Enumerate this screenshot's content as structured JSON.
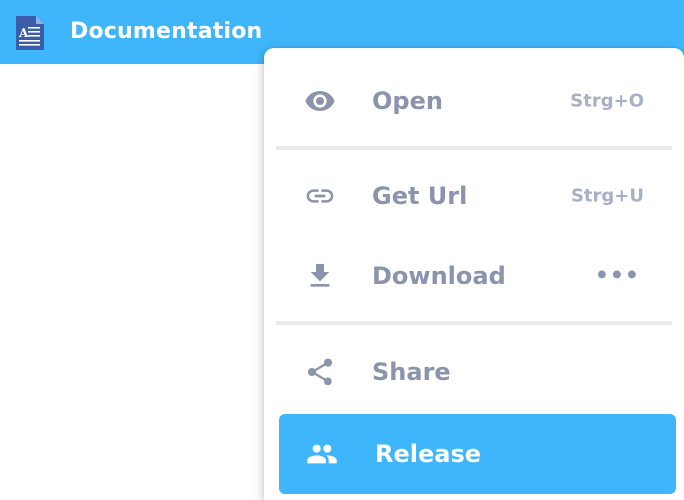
{
  "header": {
    "title": "Documentation",
    "icon": "document-icon",
    "bar_color": "#3fb6fb"
  },
  "menu": {
    "items": [
      {
        "id": "open",
        "label": "Open",
        "shortcut": "Strg+O",
        "icon": "eye-icon"
      },
      {
        "id": "get-url",
        "label": "Get Url",
        "shortcut": "Strg+U",
        "icon": "link-icon"
      },
      {
        "id": "download",
        "label": "Download",
        "more": "•••",
        "icon": "download-icon"
      },
      {
        "id": "share",
        "label": "Share",
        "icon": "share-icon"
      },
      {
        "id": "release",
        "label": "Release",
        "icon": "people-icon",
        "active": true
      }
    ],
    "active_color": "#3fb6fb",
    "text_color": "#8b93ad"
  }
}
